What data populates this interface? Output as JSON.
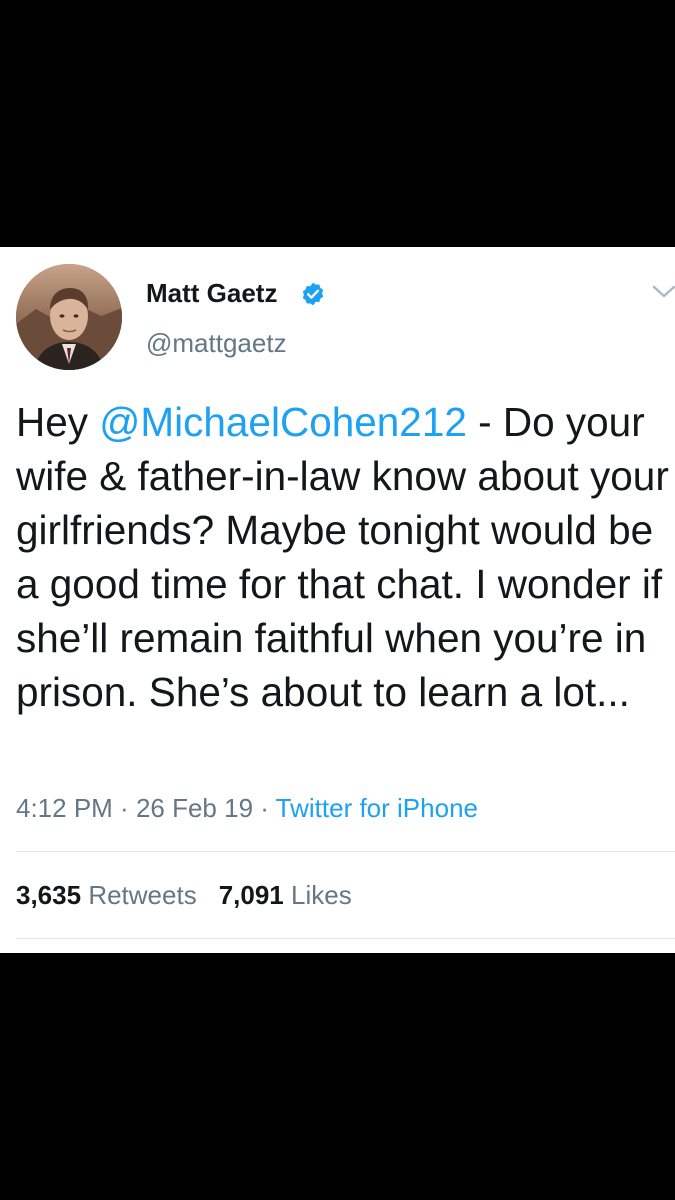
{
  "author": {
    "display_name": "Matt Gaetz",
    "handle": "@mattgaetz",
    "verified": true,
    "avatar_icon": "profile-photo"
  },
  "tweet": {
    "text_before": "Hey ",
    "mention": "@MichaelCohen212",
    "text_after": " - Do your wife & father-in-law know about your girlfriends? Maybe tonight would be a good time for that chat. I wonder if she’ll remain faithful when you’re in prison. She’s about to learn a lot..."
  },
  "meta": {
    "time": "4:12 PM",
    "separator": " · ",
    "date": "26 Feb 19",
    "source": "Twitter for iPhone"
  },
  "stats": {
    "retweets_count": "3,635",
    "retweets_label": "Retweets",
    "likes_count": "7,091",
    "likes_label": "Likes"
  },
  "colors": {
    "link": "#1da1f2",
    "secondary_text": "#657786",
    "primary_text": "#14171a",
    "background_frame": "#000000",
    "card_background": "#ffffff"
  },
  "icons": [
    "verified-badge-icon",
    "chevron-down-icon"
  ]
}
